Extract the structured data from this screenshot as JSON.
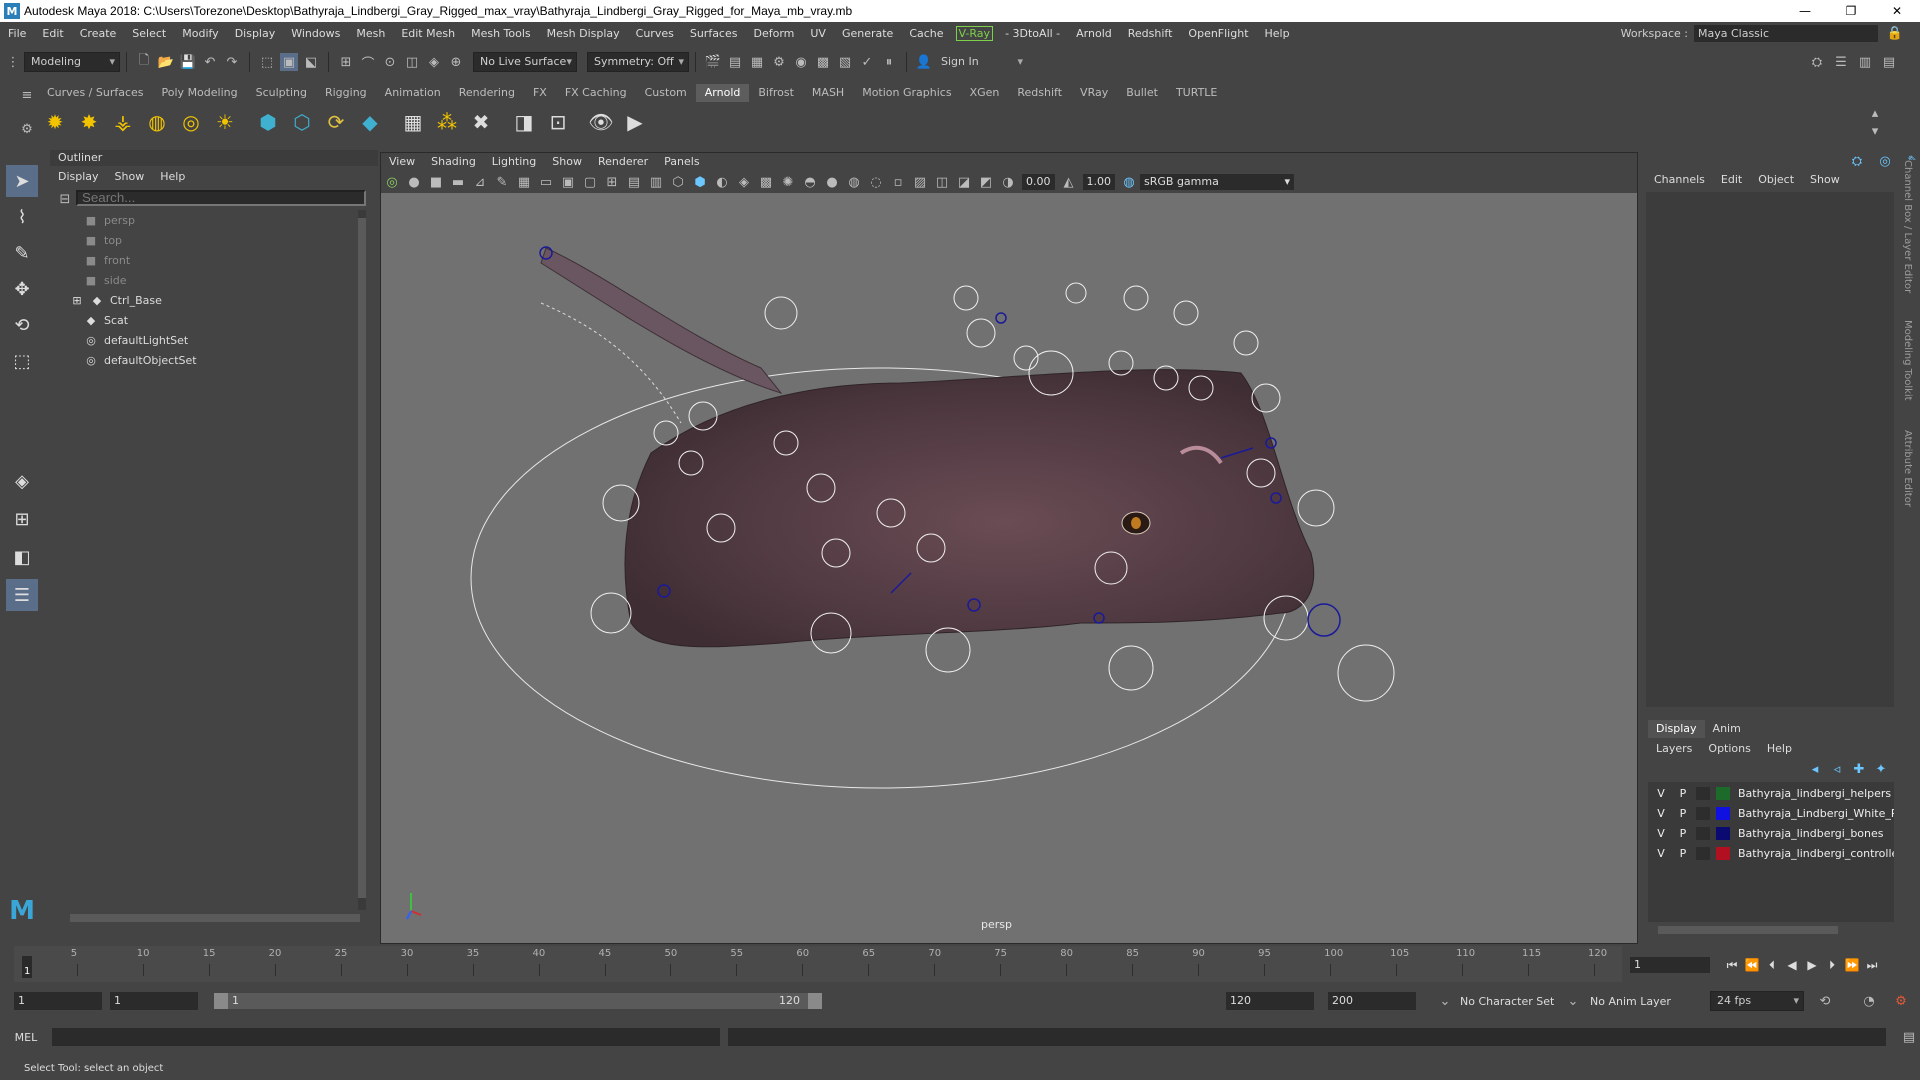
{
  "window": {
    "title": "Autodesk Maya 2018: C:\\Users\\Torezone\\Desktop\\Bathyraja_Lindbergi_Gray_Rigged_max_vray\\Bathyraja_Lindbergi_Gray_Rigged_for_Maya_mb_vray.mb",
    "logo": "M",
    "controls": [
      "—",
      "❐",
      "✕"
    ]
  },
  "menubar": {
    "items": [
      "File",
      "Edit",
      "Create",
      "Select",
      "Modify",
      "Display",
      "Windows",
      "Mesh",
      "Edit Mesh",
      "Mesh Tools",
      "Mesh Display",
      "Curves",
      "Surfaces",
      "Deform",
      "UV",
      "Generate",
      "Cache"
    ],
    "vray": "V-Ray",
    "items2": [
      "- 3DtoAll -",
      "Arnold",
      "Redshift",
      "OpenFlight",
      "Help"
    ],
    "workspace_label": "Workspace :",
    "workspace_value": "Maya Classic"
  },
  "statusline": {
    "mode": "Modeling",
    "live_surface": "No Live Surface",
    "symmetry": "Symmetry: Off",
    "sign_in": "Sign In"
  },
  "shelf": {
    "tabs": [
      "Curves / Surfaces",
      "Poly Modeling",
      "Sculpting",
      "Rigging",
      "Animation",
      "Rendering",
      "FX",
      "FX Caching",
      "Custom",
      "Arnold",
      "Bifrost",
      "MASH",
      "Motion Graphics",
      "XGen",
      "Redshift",
      "VRay",
      "Bullet",
      "TURTLE"
    ],
    "active_tab": "Arnold"
  },
  "outliner": {
    "title": "Outliner",
    "menu": [
      "Display",
      "Show",
      "Help"
    ],
    "search_placeholder": "Search...",
    "items": [
      {
        "label": "persp",
        "icon": "camera-icon",
        "dim": true
      },
      {
        "label": "top",
        "icon": "camera-icon",
        "dim": true
      },
      {
        "label": "front",
        "icon": "camera-icon",
        "dim": true
      },
      {
        "label": "side",
        "icon": "camera-icon",
        "dim": true
      },
      {
        "label": "Ctrl_Base",
        "icon": "transform-icon",
        "dim": false,
        "expandable": true
      },
      {
        "label": "Scat",
        "icon": "transform-icon",
        "dim": false
      },
      {
        "label": "defaultLightSet",
        "icon": "set-icon",
        "dim": false
      },
      {
        "label": "defaultObjectSet",
        "icon": "set-icon",
        "dim": false
      }
    ]
  },
  "viewport": {
    "menu": [
      "View",
      "Shading",
      "Lighting",
      "Show",
      "Renderer",
      "Panels"
    ],
    "exposure": "0.00",
    "gamma": "1.00",
    "color_space": "sRGB gamma",
    "camera": "persp"
  },
  "channelbox": {
    "menu": [
      "Channels",
      "Edit",
      "Object",
      "Show"
    ]
  },
  "layers": {
    "tabs": [
      "Display",
      "Anim"
    ],
    "active_tab": "Display",
    "menu": [
      "Layers",
      "Options",
      "Help"
    ],
    "rows": [
      {
        "v": "V",
        "p": "P",
        "name": "Bathyraja_lindbergi_helpers",
        "color": "#1d6b2a"
      },
      {
        "v": "V",
        "p": "P",
        "name": "Bathyraja_Lindbergi_White_Rig",
        "color": "#1010e0"
      },
      {
        "v": "V",
        "p": "P",
        "name": "Bathyraja_lindbergi_bones",
        "color": "#0a0a70"
      },
      {
        "v": "V",
        "p": "P",
        "name": "Bathyraja_lindbergi_controllers",
        "color": "#b01020"
      }
    ]
  },
  "side_tabs": [
    "Channel Box / Layer Editor",
    "Modeling Toolkit",
    "Attribute Editor"
  ],
  "timeline": {
    "ticks": [
      "5",
      "10",
      "15",
      "20",
      "25",
      "30",
      "35",
      "40",
      "45",
      "50",
      "55",
      "60",
      "65",
      "70",
      "75",
      "80",
      "85",
      "90",
      "95",
      "100",
      "105",
      "110",
      "115",
      "120"
    ],
    "start_marker": "1",
    "current_frame": "1"
  },
  "range": {
    "start": "1",
    "playback_start": "1",
    "slider_start": "1",
    "slider_end": "120",
    "playback_end": "120",
    "end": "200",
    "character_set": "No Character Set",
    "anim_layer": "No Anim Layer",
    "fps": "24 fps"
  },
  "command": {
    "label": "MEL"
  },
  "helpline": "Select Tool: select an object"
}
